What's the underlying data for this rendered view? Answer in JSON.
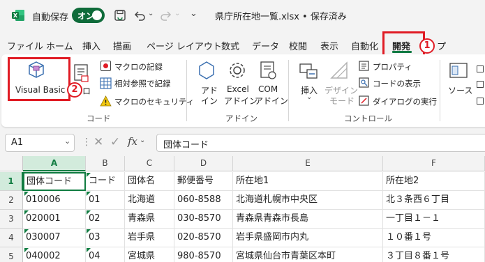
{
  "titlebar": {
    "autosave_label": "自動保存",
    "autosave_state": "オン",
    "filename": "県庁所在地一覧.xlsx • 保存済み",
    "icons": [
      "excel-logo-icon",
      "save-icon",
      "undo-icon",
      "redo-icon",
      "customize-icon"
    ]
  },
  "tabs": [
    {
      "label": "ファイル"
    },
    {
      "label": "ホーム"
    },
    {
      "label": "挿入"
    },
    {
      "label": "描画"
    },
    {
      "label": "ページ レイアウト"
    },
    {
      "label": "数式"
    },
    {
      "label": "データ"
    },
    {
      "label": "校閲"
    },
    {
      "label": "表示"
    },
    {
      "label": "自動化"
    },
    {
      "label": "開発"
    },
    {
      "label": "プ"
    }
  ],
  "annotations": {
    "one": "1",
    "two": "2"
  },
  "ribbon": {
    "code": {
      "visual_basic": "Visual Basic",
      "macro_cut": "ロ",
      "record_macro": "マクロの記録",
      "relative_ref": "相対参照で記録",
      "macro_security": "マクロのセキュリティ",
      "group_label": "コード"
    },
    "addins": {
      "addin_line1": "アド",
      "addin_line2": "イン",
      "excel_addin_line1": "Excel",
      "excel_addin_line2": "アドイン",
      "com_addin_line1": "COM",
      "com_addin_line2": "アドイン",
      "group_label": "アドイン"
    },
    "controls": {
      "insert": "挿入",
      "design_line1": "デザイン",
      "design_line2": "モード",
      "properties": "プロパティ",
      "view_code": "コードの表示",
      "run_dialog": "ダイアログの実行",
      "group_label": "コントロール"
    },
    "xml": {
      "source": "ソース"
    }
  },
  "formula_bar": {
    "name_box": "A1",
    "formula": "団体コード"
  },
  "sheet": {
    "columns": [
      "A",
      "B",
      "C",
      "D",
      "E",
      "F"
    ],
    "rows": [
      "1",
      "2",
      "3",
      "4",
      "5"
    ],
    "data": [
      [
        "団体コード",
        "コード",
        "団体名",
        "郵便番号",
        "所在地1",
        "所在地2"
      ],
      [
        "010006",
        "01",
        "北海道",
        "060-8588",
        "北海道札幌市中央区",
        "北３条西６丁目"
      ],
      [
        "020001",
        "02",
        "青森県",
        "030-8570",
        "青森県青森市長島",
        "一丁目１－１"
      ],
      [
        "030007",
        "03",
        "岩手県",
        "020-8570",
        "岩手県盛岡市内丸",
        "１０番１号"
      ],
      [
        "040002",
        "04",
        "宮城県",
        "980-8570",
        "宮城県仙台市青葉区本町",
        "３丁目８番１号"
      ]
    ]
  },
  "colors": {
    "accent": "#107c41",
    "highlight": "#e01b24"
  }
}
